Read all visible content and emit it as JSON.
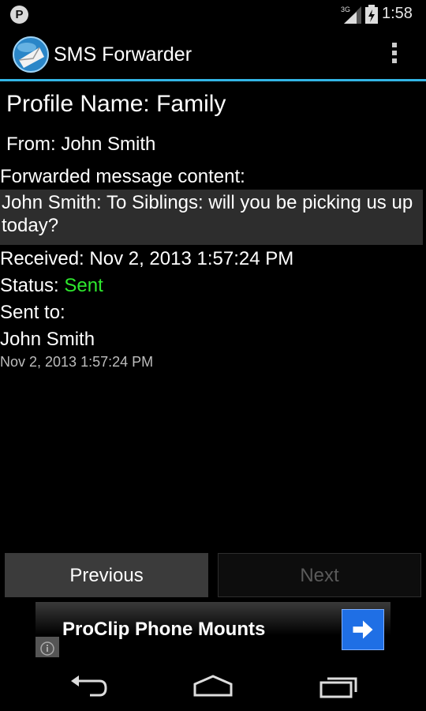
{
  "status_bar": {
    "notification_icon_letter": "P",
    "network_label": "3G",
    "time": "1:58"
  },
  "action_bar": {
    "app_title": "SMS Forwarder",
    "app_icon": "envelope-globe-icon",
    "overflow_icon": "overflow-menu-icon"
  },
  "detail": {
    "profile_name": "Profile Name: Family",
    "from": "From: John Smith",
    "forwarded_label": "Forwarded message content:",
    "message": "John Smith: To Siblings: will you be picking us up today?",
    "received": "Received: Nov 2, 2013 1:57:24 PM",
    "status_label": "Status: ",
    "status_value": "Sent",
    "sent_to_label": "Sent to:",
    "recipient_name": "John Smith",
    "recipient_time": "Nov 2, 2013 1:57:24 PM"
  },
  "buttons": {
    "previous": "Previous",
    "next": "Next"
  },
  "ad": {
    "text": "ProClip Phone Mounts",
    "arrow_icon": "arrow-right-icon",
    "info_icon": "info-icon"
  },
  "colors": {
    "accent": "#33b5e5",
    "status_sent": "#2ee82e",
    "ad_button": "#1f6fe5"
  },
  "nav_bar": {
    "back_icon": "back-icon",
    "home_icon": "home-icon",
    "recents_icon": "recents-icon"
  }
}
